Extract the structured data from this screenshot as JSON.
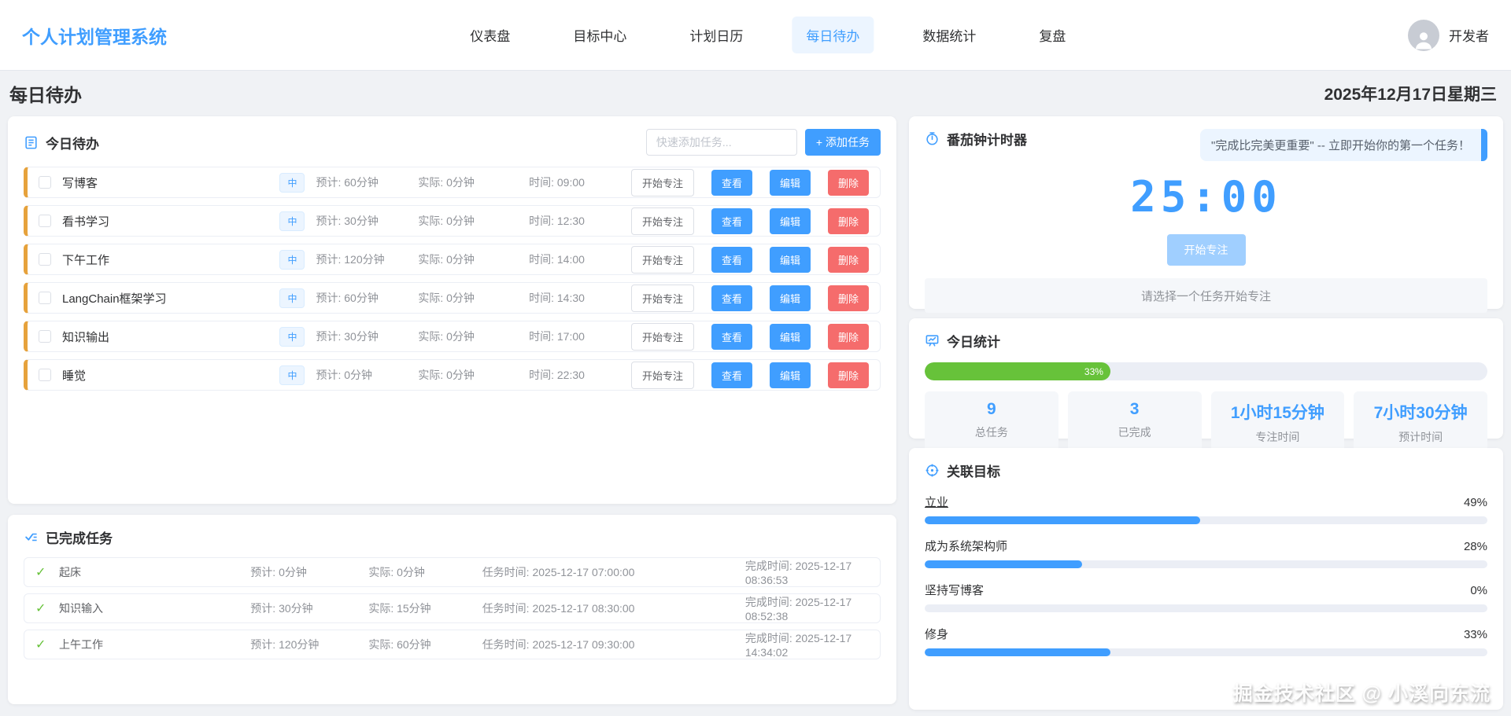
{
  "header": {
    "logo": "个人计划管理系统",
    "nav": [
      {
        "label": "仪表盘",
        "active": false
      },
      {
        "label": "目标中心",
        "active": false
      },
      {
        "label": "计划日历",
        "active": false
      },
      {
        "label": "每日待办",
        "active": true
      },
      {
        "label": "数据统计",
        "active": false
      },
      {
        "label": "复盘",
        "active": false
      }
    ],
    "user": "开发者"
  },
  "page": {
    "title": "每日待办",
    "date": "2025年12月17日星期三"
  },
  "todo": {
    "title": "今日待办",
    "quick_add_placeholder": "快速添加任务...",
    "add_button": "+ 添加任务",
    "focus_button": "开始专注",
    "view_button": "查看",
    "edit_button": "编辑",
    "delete_button": "删除",
    "tasks": [
      {
        "name": "写博客",
        "priority": "中",
        "estimate": "预计: 60分钟",
        "actual": "实际: 0分钟",
        "time": "时间: 09:00"
      },
      {
        "name": "看书学习",
        "priority": "中",
        "estimate": "预计: 30分钟",
        "actual": "实际: 0分钟",
        "time": "时间: 12:30"
      },
      {
        "name": "下午工作",
        "priority": "中",
        "estimate": "预计: 120分钟",
        "actual": "实际: 0分钟",
        "time": "时间: 14:00"
      },
      {
        "name": "LangChain框架学习",
        "priority": "中",
        "estimate": "预计: 60分钟",
        "actual": "实际: 0分钟",
        "time": "时间: 14:30"
      },
      {
        "name": "知识输出",
        "priority": "中",
        "estimate": "预计: 30分钟",
        "actual": "实际: 0分钟",
        "time": "时间: 17:00"
      },
      {
        "name": "睡觉",
        "priority": "中",
        "estimate": "预计: 0分钟",
        "actual": "实际: 0分钟",
        "time": "时间: 22:30"
      }
    ]
  },
  "completed": {
    "title": "已完成任务",
    "check_mark": "✓",
    "tasks": [
      {
        "name": "起床",
        "estimate": "预计: 0分钟",
        "actual": "实际: 0分钟",
        "task_time": "任务时间: 2025-12-17 07:00:00",
        "done_time": "完成时间: 2025-12-17 08:36:53"
      },
      {
        "name": "知识输入",
        "estimate": "预计: 30分钟",
        "actual": "实际: 15分钟",
        "task_time": "任务时间: 2025-12-17 08:30:00",
        "done_time": "完成时间: 2025-12-17 08:52:38"
      },
      {
        "name": "上午工作",
        "estimate": "预计: 120分钟",
        "actual": "实际: 60分钟",
        "task_time": "任务时间: 2025-12-17 09:30:00",
        "done_time": "完成时间: 2025-12-17 14:34:02"
      }
    ]
  },
  "pomodoro": {
    "title": "番茄钟计时器",
    "quote": "\"完成比完美更重要\" -- 立即开始你的第一个任务！",
    "timer": "25:00",
    "start_button": "开始专注",
    "hint": "请选择一个任务开始专注"
  },
  "stats": {
    "title": "今日统计",
    "progress_percent": 33,
    "progress_label": "33%",
    "items": [
      {
        "value": "9",
        "label": "总任务"
      },
      {
        "value": "3",
        "label": "已完成"
      },
      {
        "value": "1小时15分钟",
        "label": "专注时间"
      },
      {
        "value": "7小时30分钟",
        "label": "预计时间"
      }
    ]
  },
  "goals": {
    "title": "关联目标",
    "items": [
      {
        "name": "立业",
        "percent": 49,
        "label": "49%",
        "underline": true
      },
      {
        "name": "成为系统架构师",
        "percent": 28,
        "label": "28%",
        "underline": false
      },
      {
        "name": "坚持写博客",
        "percent": 0,
        "label": "0%",
        "underline": false
      },
      {
        "name": "修身",
        "percent": 33,
        "label": "33%",
        "underline": false
      }
    ]
  },
  "watermark": "掘金技术社区 @ 小溪向东流",
  "colors": {
    "accent": "#409eff",
    "accent_light": "#ecf5ff",
    "success": "#67c23a",
    "danger": "#f56c6c",
    "task_border": "#e6a23c",
    "page_bg": "#f0f2f5"
  }
}
